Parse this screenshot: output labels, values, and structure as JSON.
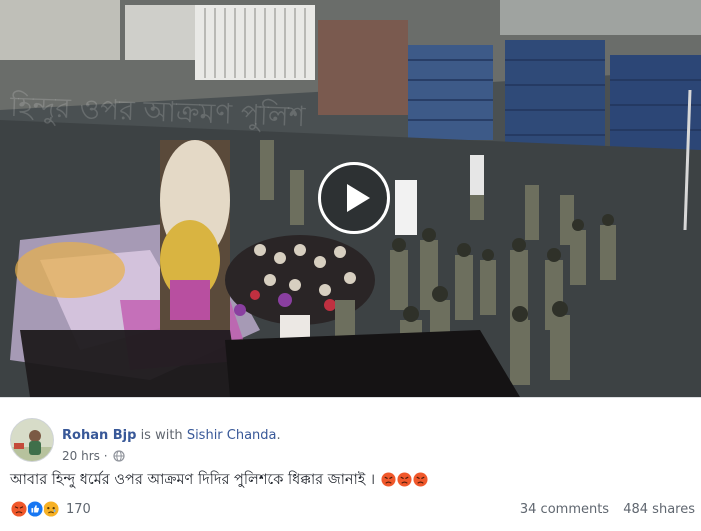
{
  "post": {
    "author": "Rohan Bjp",
    "with_text": "is with",
    "tagged": "Sishir Chanda",
    "tagged_suffix": ".",
    "time": "20 hrs",
    "time_sep": "·",
    "text": "আবার হিন্দু ধর্মের ওপর আক্রমণ দিদির পুলিশকে ধিক্কার জানাই ।"
  },
  "video": {
    "watermark": "হিন্দুর ওপর আক্রমণ পুলিশ"
  },
  "engagement": {
    "reaction_count": "170",
    "comments": "34 comments",
    "shares": "484 shares"
  },
  "colors": {
    "link": "#385898",
    "angry": "#f0582b",
    "like": "#1877f2",
    "sad": "#f7b125"
  },
  "icons": [
    "play-icon",
    "globe-icon",
    "angry-emoji-icon",
    "like-reaction-icon",
    "sad-reaction-icon"
  ]
}
